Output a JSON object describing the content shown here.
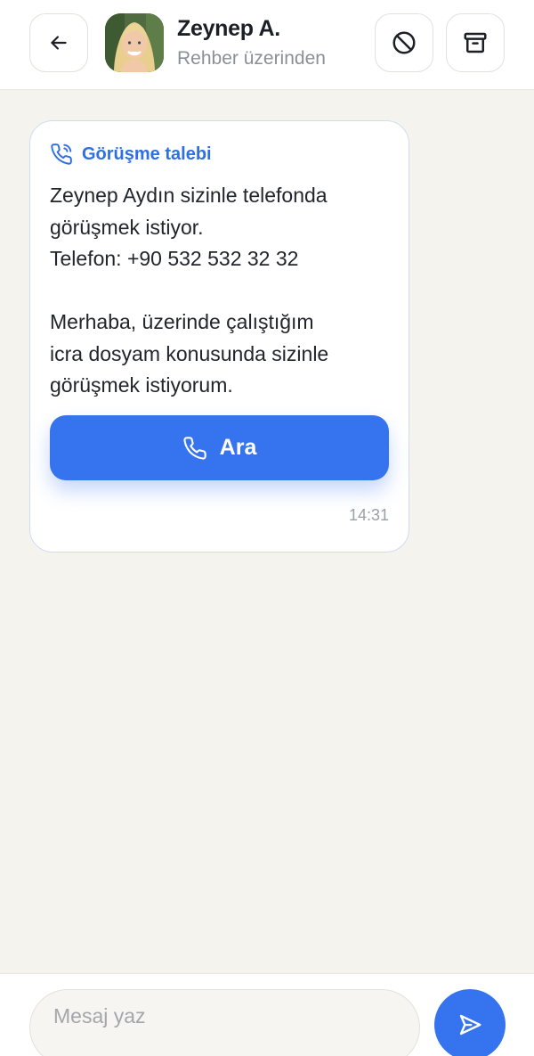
{
  "header": {
    "contact_name": "Zeynep A.",
    "contact_subtitle": "Rehber üzerinden",
    "icons": {
      "back": "arrow-left-icon",
      "block": "block-icon",
      "archive": "archive-icon"
    }
  },
  "message": {
    "title": "Görüşme talebi",
    "title_icon": "phone-incoming-icon",
    "body": "Zeynep Aydın sizinle telefonda\ngörüşmek istiyor.\nTelefon: +90 532 532 32 32\n\nMerhaba, üzerinde çalıştığım\nicra dosyam konusunda sizinle\ngörüşmek istiyorum.",
    "call_button_label": "Ara",
    "call_icon": "phone-icon",
    "time": "14:31"
  },
  "composer": {
    "placeholder": "Mesaj yaz",
    "value": "",
    "send_icon": "send-icon"
  },
  "colors": {
    "accent": "#3574ee",
    "title_accent": "#2f6fe4",
    "background": "#f5f3ee",
    "card_border": "#cfdcf2"
  }
}
